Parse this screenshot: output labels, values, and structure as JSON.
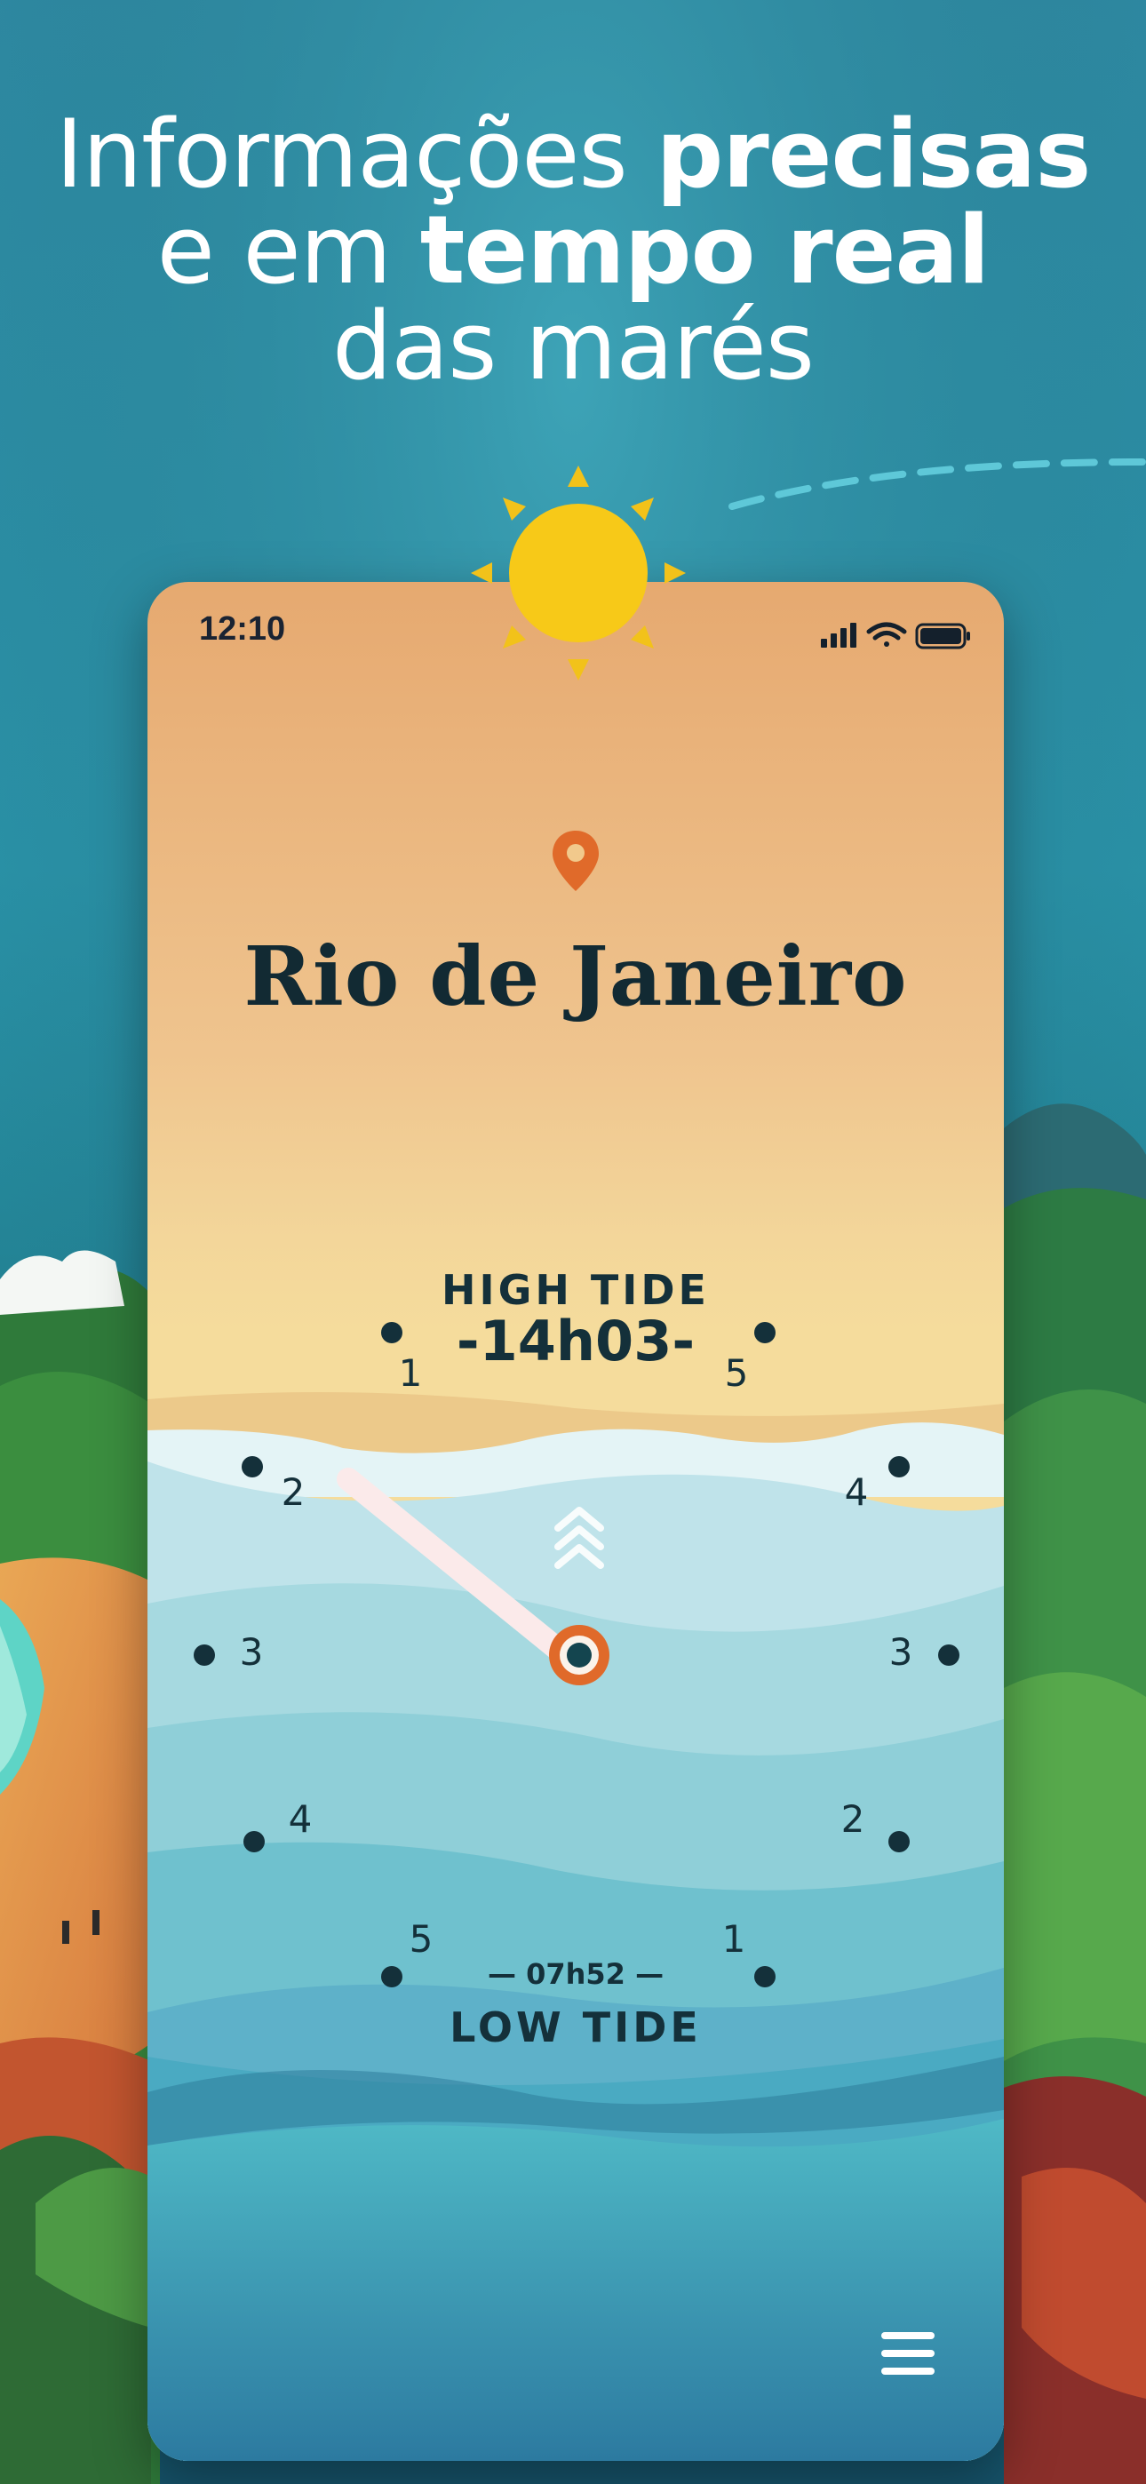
{
  "headline": {
    "line1_light": "Informações ",
    "line1_bold": "precisas",
    "line2_light": "e em ",
    "line2_bold": "tempo real",
    "line3_light": "das marés"
  },
  "status_bar": {
    "time": "12:10",
    "icons": [
      "signal-icon",
      "wifi-icon",
      "battery-icon"
    ]
  },
  "location": {
    "icon": "location-pin-icon",
    "city": "Rio de Janeiro"
  },
  "tide_clock": {
    "high_label": "HIGH TIDE",
    "high_time": "-14h03-",
    "low_time": "— 07h52 —",
    "low_label": "LOW TIDE",
    "left_numbers": [
      "1",
      "2",
      "3",
      "4",
      "5"
    ],
    "right_numbers": [
      "5",
      "4",
      "3",
      "2",
      "1"
    ],
    "rising_indicator": "chevrons-up-icon"
  },
  "menu": {
    "icon": "hamburger-menu-icon"
  },
  "colors": {
    "accent": "#e06a2a",
    "ink": "#14303a",
    "sun": "#f7c918"
  }
}
